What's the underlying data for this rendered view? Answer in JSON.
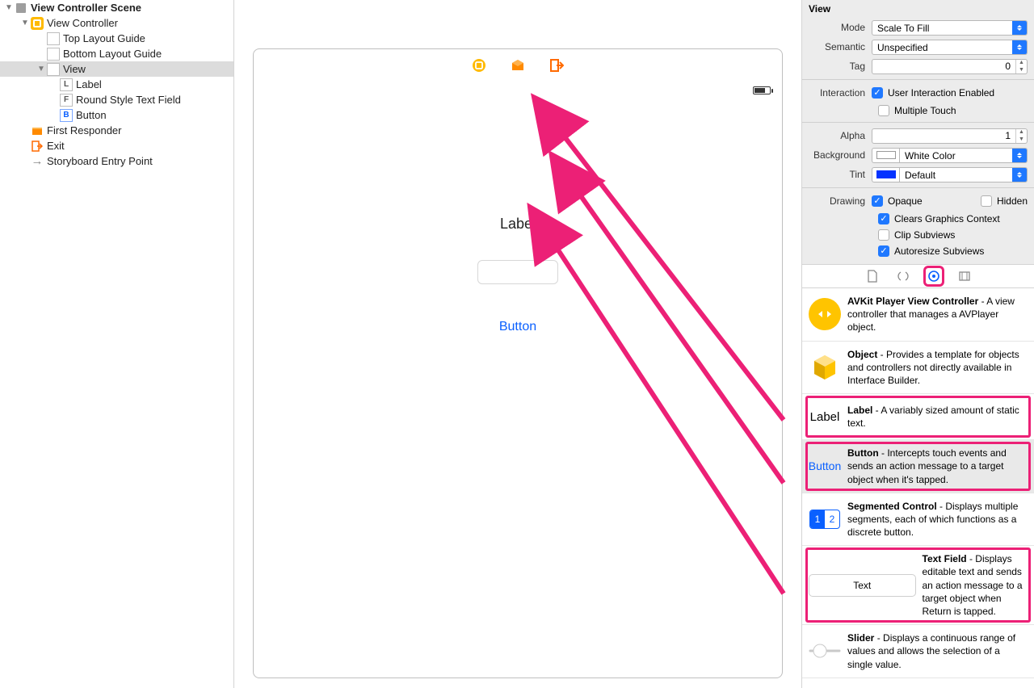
{
  "outline": {
    "scene_title": "View Controller Scene",
    "items": {
      "view_controller": "View Controller",
      "top_guide": "Top Layout Guide",
      "bottom_guide": "Bottom Layout Guide",
      "view": "View",
      "label": "Label",
      "text_field": "Round Style Text Field",
      "button": "Button",
      "first_responder": "First Responder",
      "exit": "Exit",
      "entry_point": "Storyboard Entry Point"
    },
    "letters": {
      "label": "L",
      "field": "F",
      "button": "B"
    }
  },
  "canvas": {
    "label_text": "Label",
    "button_text": "Button"
  },
  "inspector": {
    "heading": "View",
    "mode_label": "Mode",
    "mode_value": "Scale To Fill",
    "semantic_label": "Semantic",
    "semantic_value": "Unspecified",
    "tag_label": "Tag",
    "tag_value": "0",
    "interaction_label": "Interaction",
    "user_interaction": "User Interaction Enabled",
    "multiple_touch": "Multiple Touch",
    "alpha_label": "Alpha",
    "alpha_value": "1",
    "background_label": "Background",
    "background_value": "White Color",
    "background_color": "#ffffff",
    "tint_label": "Tint",
    "tint_value": "Default",
    "tint_color": "#0433ff",
    "drawing_label": "Drawing",
    "opaque": "Opaque",
    "hidden": "Hidden",
    "clears": "Clears Graphics Context",
    "clip": "Clip Subviews",
    "autoresize": "Autoresize Subviews"
  },
  "library": {
    "items": [
      {
        "id": "avkit",
        "title": "AVKit Player View Controller",
        "desc": " - A view controller that manages a AVPlayer object.",
        "thumb": "av",
        "highlight": false
      },
      {
        "id": "object",
        "title": "Object",
        "desc": " - Provides a template for objects and controllers not directly available in Interface Builder.",
        "thumb": "obj",
        "highlight": false
      },
      {
        "id": "label",
        "title": "Label",
        "desc": " - A variably sized amount of static text.",
        "thumb": "lbl",
        "thumb_text": "Label",
        "highlight": true
      },
      {
        "id": "button",
        "title": "Button",
        "desc": " - Intercepts touch events and sends an action message to a target object when it's tapped.",
        "thumb": "btn",
        "thumb_text": "Button",
        "highlight": true,
        "selected": true
      },
      {
        "id": "segmented",
        "title": "Segmented Control",
        "desc": " - Displays multiple segments, each of which functions as a discrete button.",
        "thumb": "seg",
        "highlight": false
      },
      {
        "id": "textfield",
        "title": "Text Field",
        "desc": " - Displays editable text and sends an action message to a target object when Return is tapped.",
        "thumb": "txt",
        "thumb_text": "Text",
        "highlight": true
      },
      {
        "id": "slider",
        "title": "Slider",
        "desc": " - Displays a continuous range of values and allows the selection of a single value.",
        "thumb": "sld",
        "highlight": false
      }
    ]
  },
  "colors": {
    "accent_pink": "#ec2076",
    "ios_blue": "#0a60ff"
  }
}
